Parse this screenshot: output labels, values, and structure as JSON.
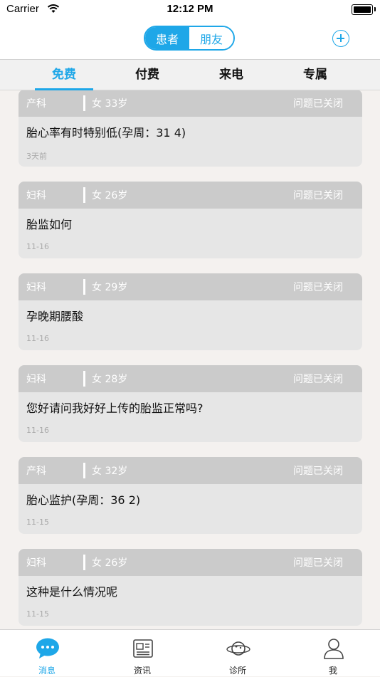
{
  "status_bar": {
    "carrier": "Carrier",
    "time": "12:12 PM"
  },
  "navbar": {
    "segments": [
      {
        "label": "患者",
        "active": true
      },
      {
        "label": "朋友",
        "active": false
      }
    ],
    "add_icon": "plus-circle-icon",
    "accent_color": "#1ea7e8"
  },
  "tabs": [
    {
      "label": "免费",
      "active": true
    },
    {
      "label": "付费",
      "active": false
    },
    {
      "label": "来电",
      "active": false
    },
    {
      "label": "专属",
      "active": false
    }
  ],
  "cards": [
    {
      "dept": "产科",
      "patient": "女  33岁",
      "status": "问题已关闭",
      "question": "胎心率有时特别低(孕周：31 4)",
      "date": "3天前"
    },
    {
      "dept": "妇科",
      "patient": "女  26岁",
      "status": "问题已关闭",
      "question": "胎监如何",
      "date": "11-16"
    },
    {
      "dept": "妇科",
      "patient": "女  29岁",
      "status": "问题已关闭",
      "question": "孕晚期腰酸",
      "date": "11-16"
    },
    {
      "dept": "妇科",
      "patient": "女  28岁",
      "status": "问题已关闭",
      "question": "您好请问我好好上传的胎监正常吗?",
      "date": "11-16"
    },
    {
      "dept": "产科",
      "patient": "女  32岁",
      "status": "问题已关闭",
      "question": "胎心监护(孕周：36 2)",
      "date": "11-15"
    },
    {
      "dept": "妇科",
      "patient": "女  26岁",
      "status": "问题已关闭",
      "question": "这种是什么情况呢",
      "date": "11-15"
    }
  ],
  "bottom_tabs": [
    {
      "label": "消息",
      "icon": "chat-bubble-icon",
      "active": true
    },
    {
      "label": "资讯",
      "icon": "newspaper-icon",
      "active": false
    },
    {
      "label": "诊所",
      "icon": "planet-icon",
      "active": false
    },
    {
      "label": "我",
      "icon": "person-icon",
      "active": false
    }
  ]
}
